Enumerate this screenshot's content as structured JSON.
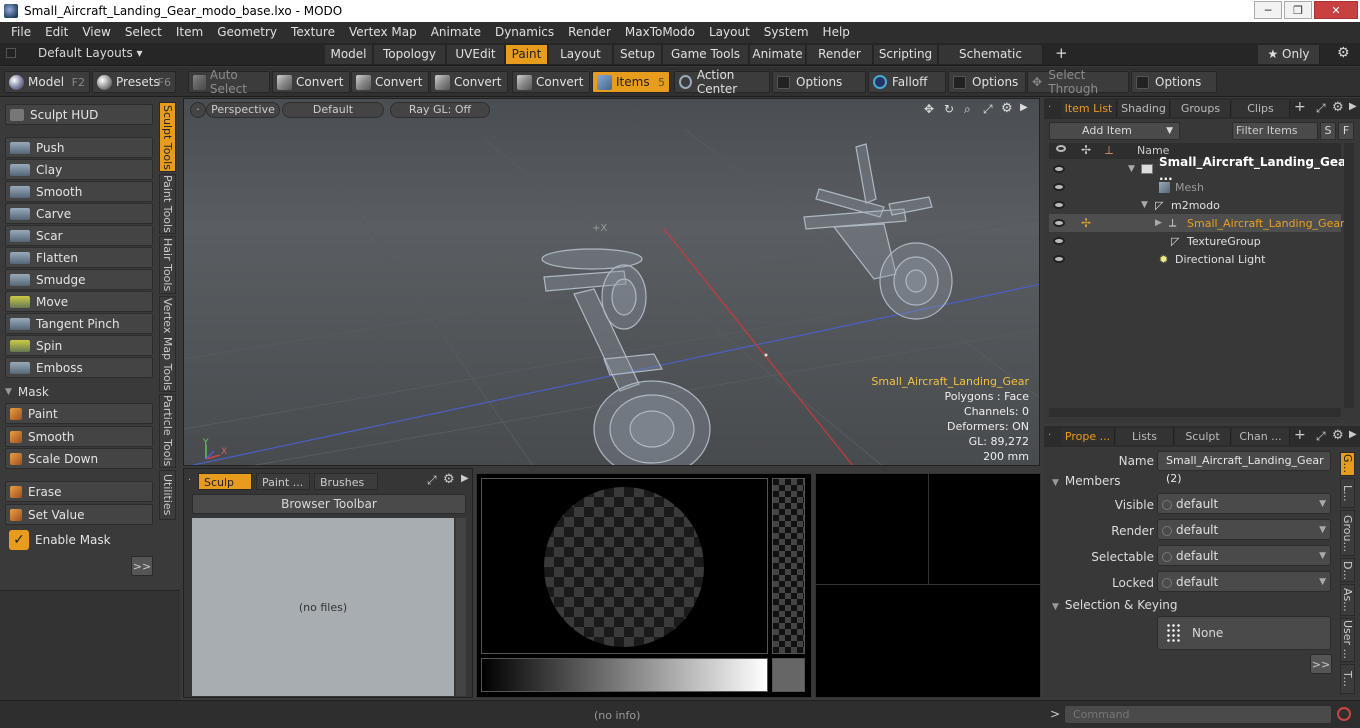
{
  "window": {
    "title": "Small_Aircraft_Landing_Gear_modo_base.lxo - MODO",
    "min": "─",
    "max": "❐",
    "close": "✕"
  },
  "menu": [
    "File",
    "Edit",
    "View",
    "Select",
    "Item",
    "Geometry",
    "Texture",
    "Vertex Map",
    "Animate",
    "Dynamics",
    "Render",
    "MaxToModo",
    "Layout",
    "System",
    "Help"
  ],
  "layouts": {
    "dropdown": "Default Layouts ▾",
    "tabs": [
      "Model",
      "Topology",
      "UVEdit",
      "Paint",
      "Layout",
      "Setup",
      "Game Tools",
      "Animate",
      "Render",
      "Scripting",
      "Schematic Fusion"
    ],
    "active_tab": "Paint",
    "plus": "+",
    "only": "★ Only",
    "gear": "⚙"
  },
  "toolbar": {
    "model": "Model",
    "model_key": "F2",
    "presets": "Presets",
    "presets_key": "F6",
    "auto_select": "Auto Select",
    "convert1": "Convert",
    "convert2": "Convert",
    "convert3": "Convert",
    "convert4": "Convert",
    "items": "Items",
    "items_key": "5",
    "action_center": "Action Center",
    "options1": "Options",
    "falloff": "Falloff",
    "options2": "Options",
    "select_through": "Select Through",
    "options3": "Options"
  },
  "sculpt": {
    "hud": "Sculpt HUD",
    "tools": [
      "Push",
      "Clay",
      "Smooth",
      "Carve",
      "Scar",
      "Flatten",
      "Smudge",
      "Move",
      "Tangent Pinch",
      "Spin",
      "Emboss"
    ],
    "mask_header": "Mask",
    "mask_tools": [
      "Paint",
      "Smooth",
      "Scale Down"
    ],
    "erase": "Erase",
    "set_value": "Set Value",
    "enable_mask": "Enable Mask",
    "more": ">>",
    "vtabs": [
      "Sculpt Tools",
      "Paint Tools",
      "Hair Tools",
      "Vertex Map Tools",
      "Particle Tools",
      "Utilities"
    ]
  },
  "viewport": {
    "perspective": "Perspective",
    "default": "Default",
    "raygl": "Ray GL: Off",
    "info_name": "Small_Aircraft_Landing_Gear",
    "polygons": "Polygons : Face",
    "channels": "Channels: 0",
    "deformers": "Deformers: ON",
    "gl": "GL: 89,272",
    "scale": "200 mm",
    "cursor_label": "+X",
    "axis_y": "Y",
    "axis_x": "X"
  },
  "browser": {
    "tabs": [
      "Sculp ...",
      "Paint ...",
      "Brushes"
    ],
    "toolbar": "Browser Toolbar",
    "empty": "(no files)"
  },
  "itemlist": {
    "tabs": [
      "Item List",
      "Shading",
      "Groups",
      "Clips"
    ],
    "plus": "+",
    "add_item": "Add Item",
    "filter_items": "Filter Items",
    "s": "S",
    "f": "F",
    "col_name": "Name",
    "rows": [
      {
        "name": "Small_Aircraft_Landing_Gea ...",
        "bold": true
      },
      {
        "name": "Mesh"
      },
      {
        "name": "m2modo"
      },
      {
        "name": "Small_Aircraft_Landing_Gear"
      },
      {
        "name": "TextureGroup"
      },
      {
        "name": "Directional Light"
      }
    ]
  },
  "properties": {
    "tabs": [
      "Prope ...",
      "Lists",
      "Sculpt",
      "Chan ..."
    ],
    "plus": "+",
    "name_label": "Name",
    "name_value": "Small_Aircraft_Landing_Gear (2)",
    "members": "Members",
    "visible_label": "Visible",
    "visible": "default",
    "render_label": "Render",
    "render": "default",
    "selectable_label": "Selectable",
    "selectable": "default",
    "locked_label": "Locked",
    "locked": "default",
    "selection_keying": "Selection & Keying",
    "none": "None",
    "more": ">>",
    "side_tabs": [
      "G...",
      "L...",
      "Grou...",
      "D...",
      "As...",
      "User ...",
      "T..."
    ]
  },
  "status": {
    "info": "(no info)",
    "prompt": ">",
    "command_placeholder": "Command"
  },
  "colors": {
    "accent": "#e89c1e",
    "panel": "#3a3a3a",
    "selection": "#e8a020"
  }
}
